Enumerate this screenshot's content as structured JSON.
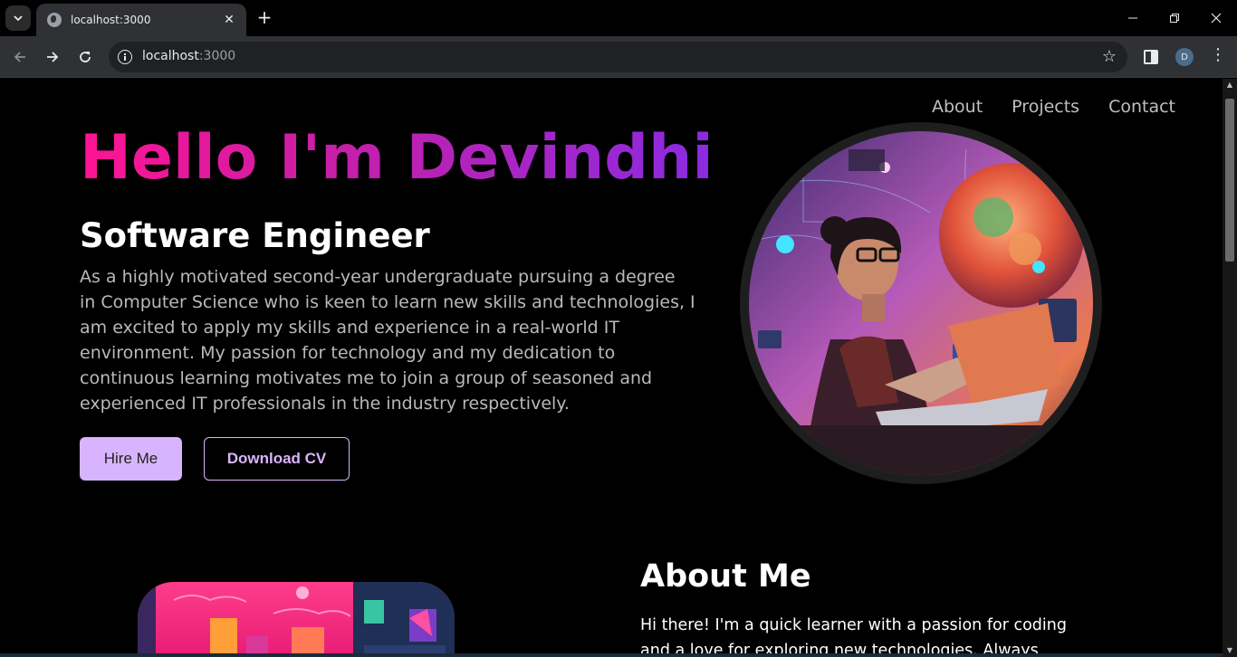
{
  "browser": {
    "tab_title": "localhost:3000",
    "url_host": "localhost",
    "url_port": ":3000",
    "profile_initial": "D"
  },
  "nav": {
    "items": [
      "About",
      "Projects",
      "Contact"
    ]
  },
  "hero": {
    "title": "Hello I'm Devindhi",
    "role": "Software Engineer",
    "bio": "As a highly motivated second-year undergraduate pursuing a degree in Computer Science who is keen to learn new skills and technologies, I am excited to apply my skills and experience in a real-world IT environment. My passion for technology and my dedication to continuous learning motivates me to join a group of seasoned and experienced IT professionals in the industry respectively.",
    "hire_label": "Hire Me",
    "cv_label": "Download CV",
    "gradient_colors": [
      "#ff1493",
      "#8a2be2"
    ]
  },
  "about": {
    "heading": "About Me",
    "text": "Hi there! I'm a quick learner with a passion for coding and a love for exploring new technologies. Always eager to dive"
  },
  "colors": {
    "accent": "#d8b4fe",
    "background": "#000000"
  }
}
